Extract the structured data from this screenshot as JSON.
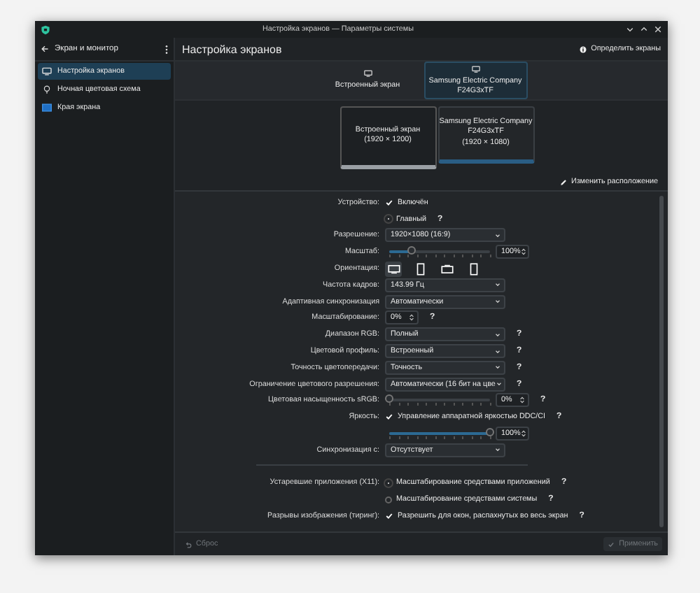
{
  "window": {
    "title": "Настройка экранов — Параметры системы"
  },
  "sidebar": {
    "back_label": "Экран и монитор",
    "items": [
      {
        "label": "Настройка экранов",
        "selected": true
      },
      {
        "label": "Ночная цветовая схема",
        "selected": false
      },
      {
        "label": "Края экрана",
        "selected": false
      }
    ]
  },
  "page": {
    "title": "Настройка экранов",
    "identify_button": "Определить экраны"
  },
  "output_tabs": [
    {
      "lines": [
        "Встроенный экран"
      ],
      "selected": false
    },
    {
      "lines": [
        "Samsung Electric Company",
        "F24G3xTF"
      ],
      "selected": true
    }
  ],
  "arrangement": [
    {
      "lines": [
        "Встроенный экран",
        "(1920 × 1200)"
      ],
      "selected": false
    },
    {
      "lines": [
        "Samsung Electric Company",
        "F24G3xTF",
        "(1920 × 1080)"
      ],
      "selected": true
    }
  ],
  "rearrange_button": "Изменить расположение",
  "settings": [
    {
      "kind": "checkbox",
      "label": "Устройство:",
      "text": "Включён",
      "checked": true
    },
    {
      "kind": "radio",
      "text": "Главный",
      "selected": true,
      "help": "?"
    },
    {
      "kind": "select",
      "label": "Разрешение:",
      "value": "1920×1080 (16:9)"
    },
    {
      "kind": "slider",
      "label": "Масштаб:",
      "level": 0.22,
      "value": "100%"
    },
    {
      "kind": "orientation",
      "label": "Ориентация:",
      "options": [
        {
          "kind": "landscape",
          "selected": true
        },
        {
          "kind": "portrait",
          "selected": false
        },
        {
          "kind": "flipped",
          "selected": false
        },
        {
          "kind": "portrait",
          "selected": false
        }
      ]
    },
    {
      "kind": "select",
      "label": "Частота кадров:",
      "value": "143.99 Гц"
    },
    {
      "kind": "select",
      "label": "Адаптивная синхронизация",
      "value": "Автоматически"
    },
    {
      "kind": "spinbox",
      "label": "Масштабирование:",
      "value": "0%",
      "help": "?"
    },
    {
      "kind": "select",
      "label": "Диапазон RGB:",
      "value": "Полный",
      "help": "?"
    },
    {
      "kind": "select",
      "label": "Цветовой профиль:",
      "value": "Встроенный",
      "help": "?"
    },
    {
      "kind": "select",
      "label": "Точность цветопередачи:",
      "value": "Точность",
      "help": "?"
    },
    {
      "kind": "select",
      "label": "Ограничение цветового разрешения:",
      "value": "Автоматически (16 бит на цве",
      "help": "?"
    },
    {
      "kind": "slider",
      "label": "Цветовая насыщенность sRGB:",
      "level": 0,
      "value": "0%",
      "help": "?"
    },
    {
      "kind": "checkbox",
      "label": "Яркость:",
      "text": "Управление аппаратной яркостью DDC/CI",
      "checked": true,
      "help": "?"
    },
    {
      "kind": "slider",
      "level": 1,
      "value": "100%"
    },
    {
      "kind": "select",
      "label": "Синхронизация с:",
      "value": "Отсутствует"
    },
    {
      "kind": "divider"
    },
    {
      "kind": "radio",
      "label": "Устаревшие приложения (X11):",
      "text": "Масштабирование средствами приложений",
      "selected": true,
      "help": "?"
    },
    {
      "kind": "radio",
      "text": "Масштабирование средствами системы",
      "selected": false,
      "help": "?"
    },
    {
      "kind": "checkbox",
      "label": "Разрывы изображения (тиринг):",
      "text": "Разрешить для окон, распахнутых во весь экран",
      "checked": true,
      "help": "?"
    }
  ],
  "footer": {
    "reset_button": {
      "label": "Сброс",
      "disabled": true
    },
    "apply_button": {
      "label": "Применить",
      "disabled": true
    }
  }
}
